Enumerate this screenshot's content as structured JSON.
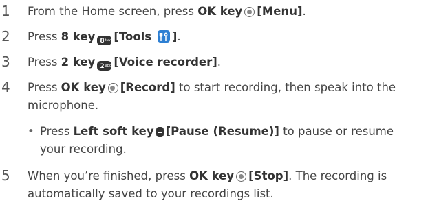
{
  "steps": [
    {
      "number": "1",
      "before": "From the Home screen, press ",
      "key": "OK key",
      "label": "[Menu]",
      "after": "."
    },
    {
      "number": "2",
      "before": "Press ",
      "key": "8 key",
      "label_open": "[Tools ",
      "label_close": "]",
      "after": "."
    },
    {
      "number": "3",
      "before": "Press ",
      "key": "2 key",
      "label": "[Voice recorder]",
      "after": "."
    },
    {
      "number": "4",
      "before": "Press ",
      "key": "OK key",
      "label": "[Record]",
      "after_line1": " to start recording, then speak into the",
      "line2": "microphone."
    },
    {
      "bullet": "•",
      "before": "Press ",
      "key": "Left soft key",
      "label": "[Pause (Resume)]",
      "after_line1": " to pause or resume",
      "line2": "your recording."
    },
    {
      "number": "5",
      "before": "When you’re finished, press ",
      "key": "OK key",
      "label": "[Stop]",
      "after_line1": ". The recording is",
      "line2": "automatically saved to your recordings list."
    }
  ],
  "keycaps": {
    "eight": "8",
    "eight_sub": "tuv",
    "two": "2",
    "two_sub": "abc"
  },
  "icons": {
    "ok_key": "ok-key-icon",
    "number_key": "number-key-icon",
    "left_soft_key": "left-soft-key-icon",
    "tools": "tools-app-icon"
  },
  "colors": {
    "text": "#444444",
    "bold_text": "#333333",
    "tools_icon_bg": "#2d7fd3"
  }
}
